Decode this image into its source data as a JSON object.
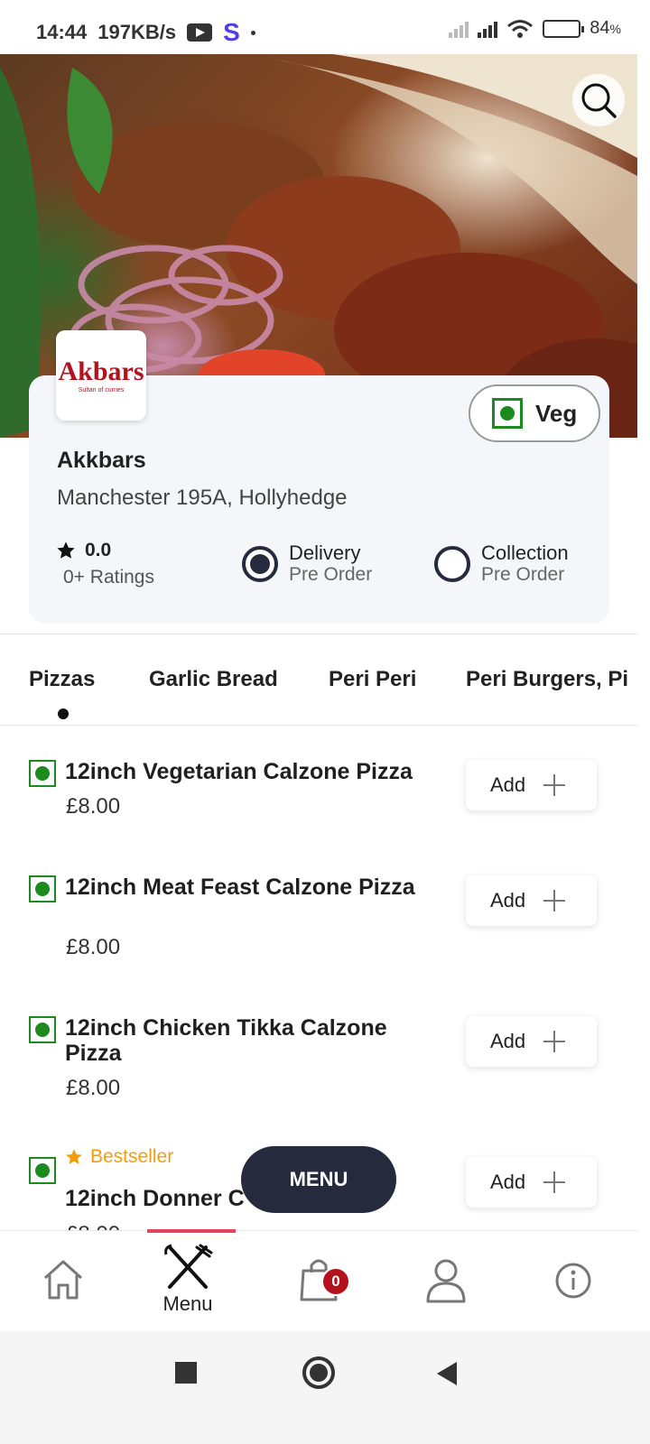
{
  "status_bar": {
    "time": "14:44",
    "network_speed": "197KB/s",
    "app_letter": "S",
    "battery_percent": "84",
    "battery_unit": "%"
  },
  "restaurant": {
    "logo_text": "Akbars",
    "logo_tagline": "Sultan of curries",
    "name": "Akkbars",
    "address": "Manchester 195A, Hollyhedge",
    "rating_value": "0.0",
    "rating_count": "0+ Ratings",
    "veg_label": "Veg",
    "delivery": {
      "title": "Delivery",
      "subtitle": "Pre Order",
      "selected": true
    },
    "collection": {
      "title": "Collection",
      "subtitle": "Pre Order",
      "selected": false
    }
  },
  "tabs": [
    "Pizzas",
    "Garlic Bread",
    "Peri Peri",
    "Peri Burgers, Pi"
  ],
  "active_tab": "Pizzas",
  "items": [
    {
      "title": "12inch Vegetarian Calzone Pizza",
      "price": "£8.00",
      "add_label": "Add"
    },
    {
      "title": "12inch Meat Feast Calzone Pizza",
      "price": "£8.00",
      "add_label": "Add"
    },
    {
      "title": "12inch Chicken Tikka Calzone Pizza",
      "price": "£8.00",
      "add_label": "Add"
    },
    {
      "badge": "Bestseller",
      "title": "12inch Donner C",
      "price": "£8.00",
      "add_label": "Add"
    }
  ],
  "menu_button": "MENU",
  "bottom_nav": {
    "menu_label": "Menu",
    "cart_count": "0",
    "accent": "#e2455a"
  },
  "colors": {
    "veg_green": "#1c8a1c",
    "bestseller_orange": "#f29d0e",
    "dark_navy": "#262a3d",
    "brand_red": "#b3121d"
  }
}
